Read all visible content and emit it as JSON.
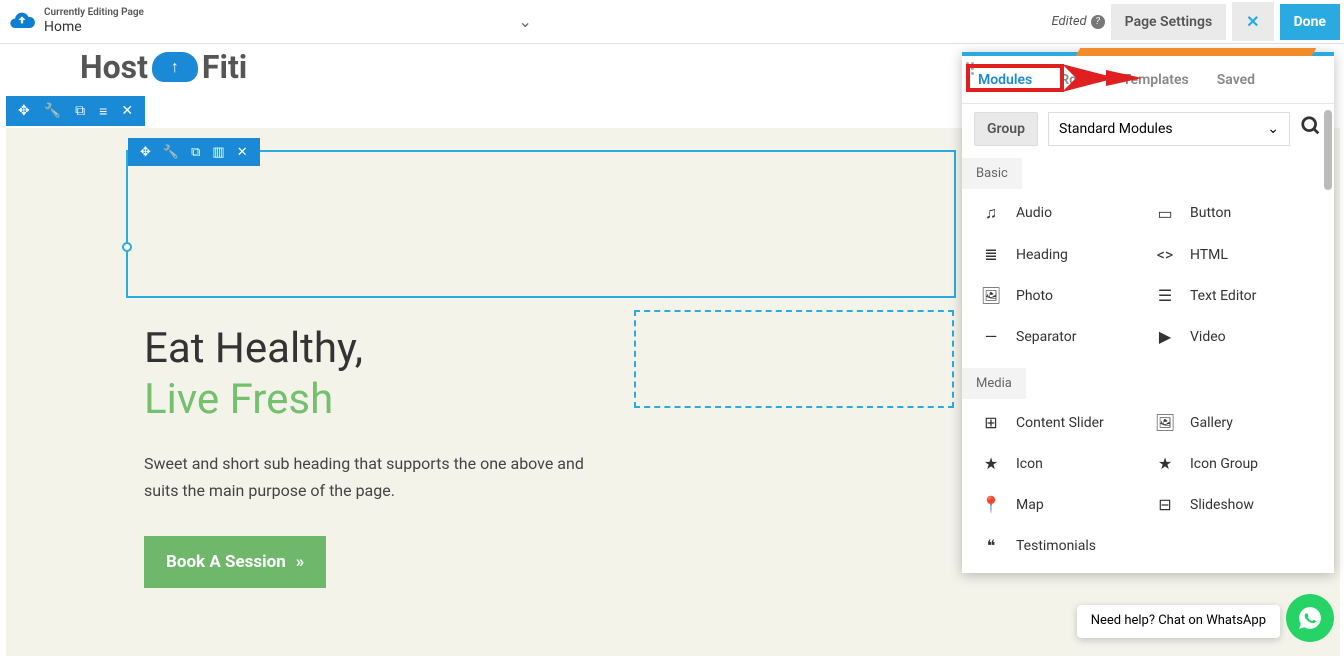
{
  "topbar": {
    "editing_label": "Currently Editing Page",
    "page_name": "Home",
    "edited_label": "Edited",
    "settings_label": "Page Settings",
    "done_label": "Done"
  },
  "logo": {
    "part1": "Host",
    "part2": "Fiti"
  },
  "hero": {
    "line1": "Eat Healthy,",
    "line2": "Live Fresh",
    "sub": "Sweet and short sub heading that supports the one above and suits the main purpose of the page.",
    "cta": "Book A Session"
  },
  "panel": {
    "tabs": {
      "modules": "Modules",
      "rows": "Rows",
      "templates": "Templates",
      "saved": "Saved"
    },
    "group_label": "Group",
    "dropdown_value": "Standard Modules",
    "cat_basic": "Basic",
    "cat_media": "Media",
    "basic": {
      "audio": "Audio",
      "button": "Button",
      "heading": "Heading",
      "html": "HTML",
      "photo": "Photo",
      "texteditor": "Text Editor",
      "separator": "Separator",
      "video": "Video"
    },
    "media": {
      "slider": "Content Slider",
      "gallery": "Gallery",
      "icon": "Icon",
      "icongroup": "Icon Group",
      "map": "Map",
      "slideshow": "Slideshow",
      "testimonials": "Testimonials"
    }
  },
  "whatsapp": {
    "text": "Need help? Chat on WhatsApp"
  }
}
